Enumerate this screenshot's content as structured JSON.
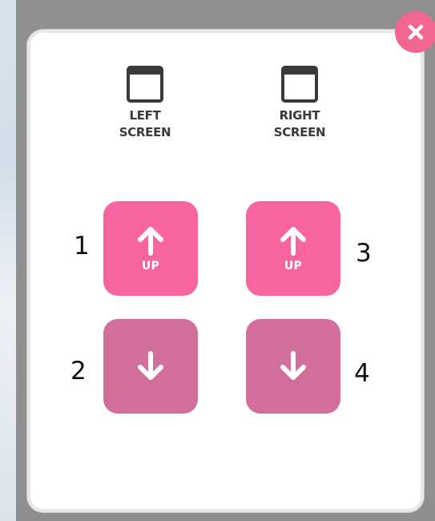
{
  "dialog": {
    "close_icon": "close-x-icon",
    "accent_color": "#f2668f"
  },
  "screens": [
    {
      "line1": "LEFT",
      "line2": "SCREEN",
      "icon": "window-icon"
    },
    {
      "line1": "RIGHT",
      "line2": "SCREEN",
      "icon": "window-icon"
    }
  ],
  "controls": {
    "up_label": "UP",
    "up_color": "#f764a0",
    "down_color": "#d26e9b",
    "up_icon": "arrow-up-icon",
    "down_icon": "arrow-down-icon"
  },
  "annotations": [
    "1",
    "2",
    "3",
    "4"
  ]
}
